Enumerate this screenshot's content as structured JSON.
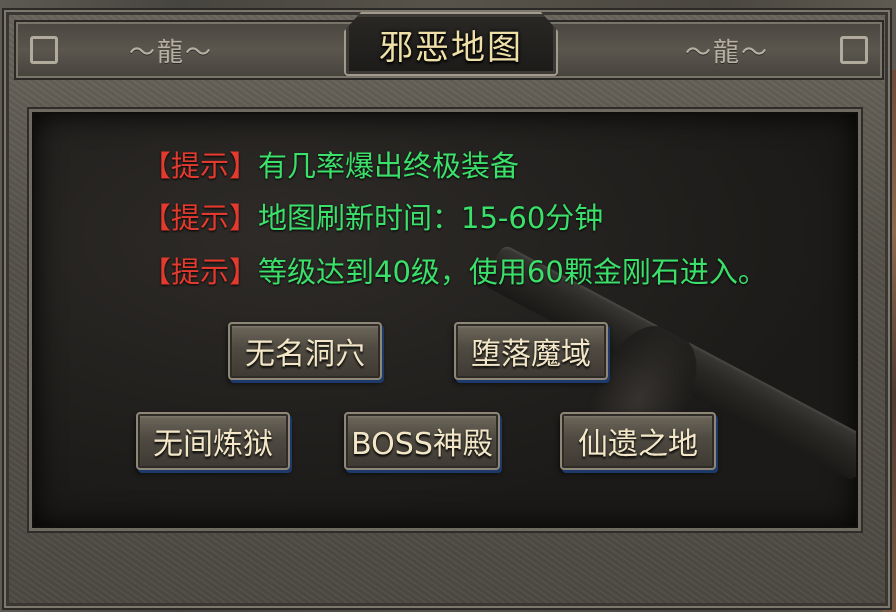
{
  "window": {
    "title": "邪恶地图",
    "left_ornament": "dragon-ornament",
    "right_ornament": "dragon-ornament"
  },
  "hints": [
    {
      "tag": "【提示】",
      "text": "有几率爆出终极装备"
    },
    {
      "tag": "【提示】",
      "text": "地图刷新时间：15-60分钟"
    },
    {
      "tag": "【提示】",
      "text": "等级达到40级，使用60颗金刚石进入。"
    }
  ],
  "buttons": [
    {
      "label": "无名洞穴"
    },
    {
      "label": "堕落魔域"
    },
    {
      "label": "无间炼狱"
    },
    {
      "label": "BOSS神殿"
    },
    {
      "label": "仙遗之地"
    }
  ],
  "colors": {
    "hint_tag": "#e23a2e",
    "hint_text": "#3be06a",
    "title_text": "#efe0a8",
    "button_text": "#f3e7c8"
  }
}
